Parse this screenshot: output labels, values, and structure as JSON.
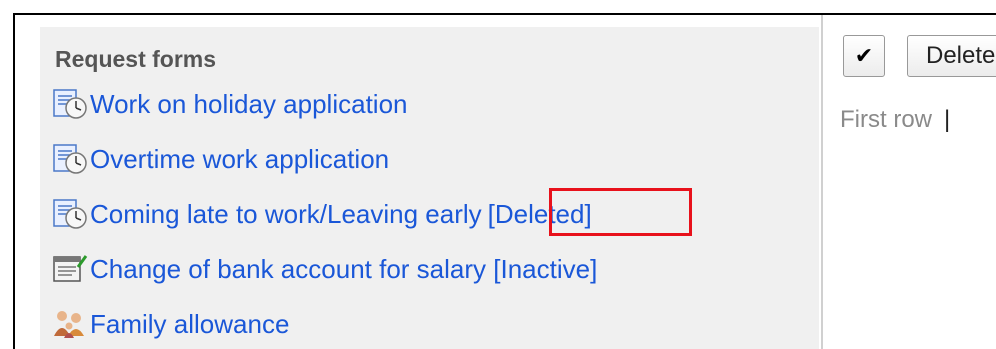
{
  "panel": {
    "title": "Request forms",
    "items": [
      {
        "label": "Work on holiday application",
        "tag": "",
        "icon": "clock-form-icon"
      },
      {
        "label": "Overtime work application",
        "tag": "",
        "icon": "clock-form-icon"
      },
      {
        "label": "Coming late to work/Leaving early",
        "tag": "[Deleted]",
        "icon": "clock-form-icon"
      },
      {
        "label": "Change of bank account for salary [Inactive]",
        "tag": "",
        "icon": "document-pencil-icon"
      },
      {
        "label": "Family allowance",
        "tag": "",
        "icon": "family-icon"
      }
    ]
  },
  "toolbar": {
    "check_label": "✔",
    "delete_label": "Delete"
  },
  "paging": {
    "first_row_label": "First row",
    "separator": "|"
  },
  "colors": {
    "link": "#1a57d8",
    "highlight": "#e8111b",
    "panel_bg": "#f0f0f0"
  }
}
